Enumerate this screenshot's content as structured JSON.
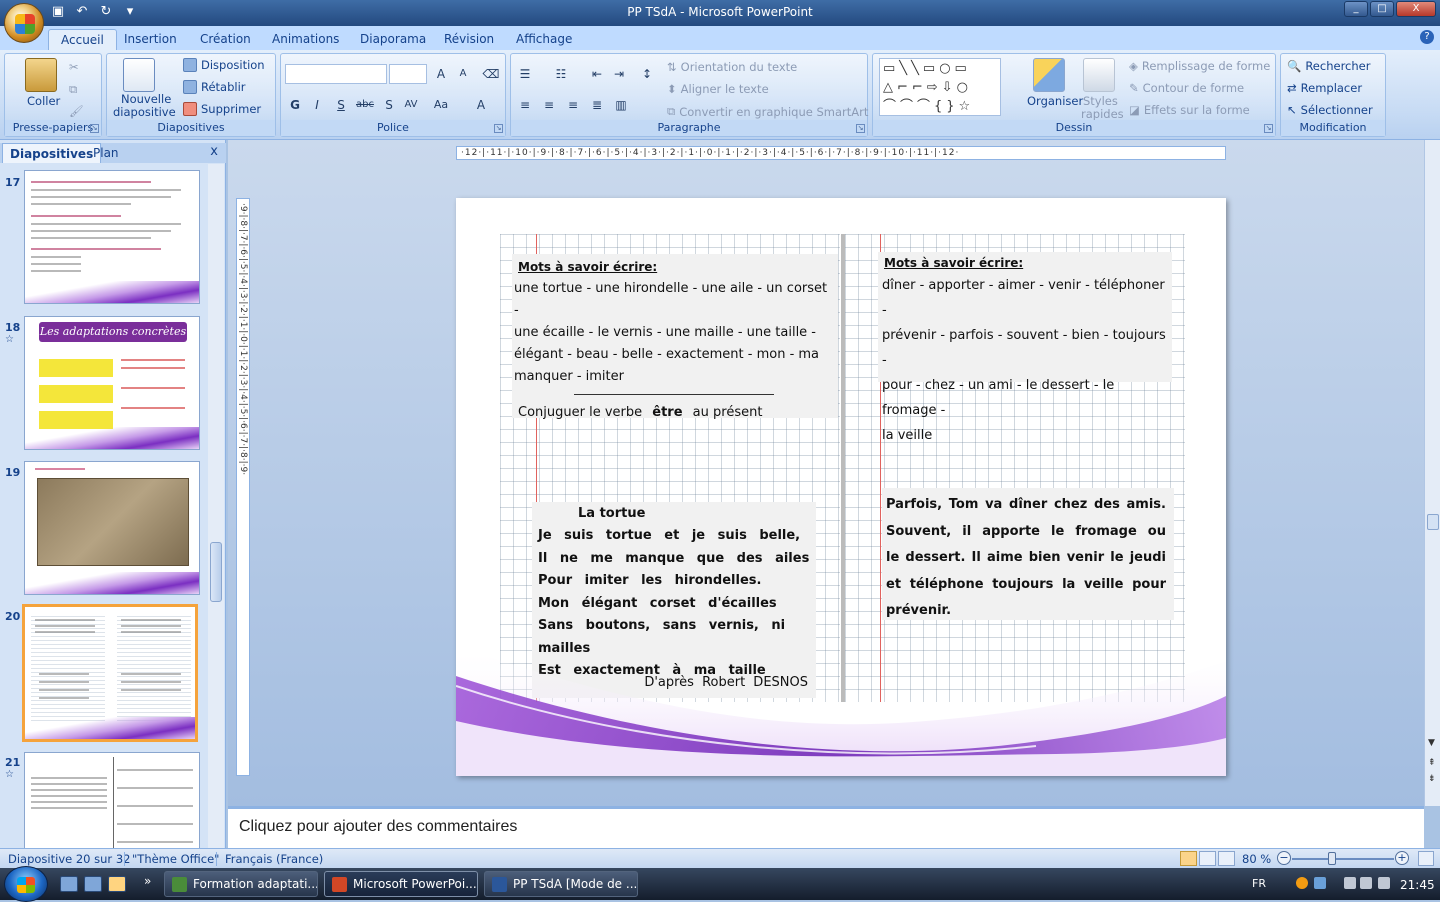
{
  "window": {
    "title": "PP TSdA - Microsoft PowerPoint",
    "min": "_",
    "max": "□",
    "close": "X"
  },
  "ribbon_tabs": [
    "Accueil",
    "Insertion",
    "Création",
    "Animations",
    "Diaporama",
    "Révision",
    "Affichage"
  ],
  "ribbon": {
    "clipboard": {
      "label": "Presse-papiers",
      "paste": "Coller"
    },
    "slides": {
      "label": "Diapositives",
      "new_slide": "Nouvelle",
      "new_slide2": "diapositive",
      "layout": "Disposition",
      "reset": "Rétablir",
      "delete": "Supprimer"
    },
    "font": {
      "label": "Police"
    },
    "paragraph": {
      "label": "Paragraphe",
      "text_direction": "Orientation du texte",
      "align_text": "Aligner le texte",
      "smartart": "Convertir en graphique SmartArt"
    },
    "drawing": {
      "label": "Dessin",
      "arrange": "Organiser",
      "styles": "Styles",
      "styles2": "rapides",
      "fill": "Remplissage de forme",
      "outline": "Contour de forme",
      "effects": "Effets sur la forme"
    },
    "editing": {
      "label": "Modification",
      "find": "Rechercher",
      "replace": "Remplacer",
      "select": "Sélectionner"
    }
  },
  "left_pane": {
    "tab_slides": "Diapositives",
    "tab_outline": "Plan",
    "close": "x",
    "thumbnails": [
      {
        "number": "17",
        "selected": false
      },
      {
        "number": "18",
        "selected": false,
        "title": "Les adaptations concrètes"
      },
      {
        "number": "19",
        "selected": false
      },
      {
        "number": "20",
        "selected": true
      },
      {
        "number": "21",
        "selected": false
      }
    ]
  },
  "ruler": {
    "horizontal": "·12·|·11·|·10·|·9·|·8·|·7·|·6·|·5·|·4·|·3·|·2·|·1·|·0·|·1·|·2·|·3·|·4·|·5·|·6·|·7·|·8·|·9·|·10·|·11·|·12·",
    "vertical": "·9·|·8·|·7·|·6·|·5·|·4·|·3·|·2·|·1·|·0·|·1·|·2·|·3·|·4·|·5·|·6·|·7·|·8·|·9·"
  },
  "slide": {
    "left_top": {
      "title": "Mots à savoir écrire:",
      "words": [
        "une tortue - une hirondelle - une aile - un corset -",
        "une écaille - le vernis - une maille - une taille -",
        "élégant - beau - belle - exactement - mon - ma",
        "manquer - imiter"
      ],
      "conjugate_prefix": "Conjuguer le verbe",
      "conjugate_verb": "être",
      "conjugate_suffix": "au présent"
    },
    "right_top": {
      "title": "Mots à savoir écrire:",
      "words": [
        "dîner - apporter - aimer - venir - téléphoner -",
        "prévenir - parfois - souvent - bien - toujours -",
        "pour - chez - un ami - le dessert - le fromage -",
        "la veille"
      ]
    },
    "poem": {
      "title": "La tortue",
      "lines": [
        "Je suis tortue et je suis belle,",
        "Il ne me manque que des ailes",
        "Pour imiter les hirondelles.",
        "Mon élégant corset d'écailles",
        "Sans boutons, sans vernis, ni mailles",
        "Est exactement à ma taille"
      ],
      "author": "D'après Robert DESNOS"
    },
    "story": {
      "lines": [
        "Parfois, Tom va dîner chez des amis.",
        "Souvent, il apporte le fromage ou",
        "le dessert. Il aime bien venir le jeudi",
        "et téléphone toujours la veille pour",
        "prévenir."
      ]
    }
  },
  "notes_placeholder": "Cliquez pour ajouter des commentaires",
  "status": {
    "slide": "Diapositive 20 sur 32",
    "theme": "\"Thème Office\"",
    "language": "Français (France)",
    "zoom": "80 %",
    "zoom_value": 80
  },
  "taskbar": {
    "items": [
      "Formation adaptati...",
      "Microsoft PowerPoi...",
      "PP TSdA [Mode de ..."
    ],
    "lang": "FR",
    "time": "21:45",
    "overflow": "»"
  },
  "colors": {
    "accent": "#15428b",
    "ribbon_bg": "#c7dbf4",
    "selected_thumb": "#f5a33c",
    "slide_wave": "#7b2fc2"
  }
}
